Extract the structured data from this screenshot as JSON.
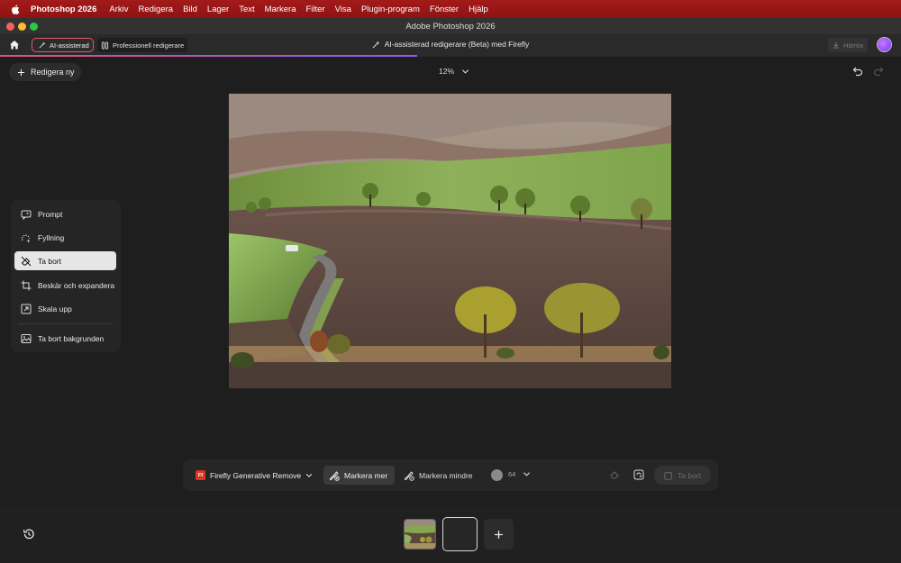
{
  "menubar": {
    "app_name": "Photoshop 2026",
    "items": [
      "Arkiv",
      "Redigera",
      "Bild",
      "Lager",
      "Text",
      "Markera",
      "Filter",
      "Visa",
      "Plugin-program",
      "Fönster",
      "Hjälp"
    ]
  },
  "window": {
    "title": "Adobe Photoshop 2026"
  },
  "toolbar": {
    "mode_ai": "AI-assisterad",
    "mode_pro": "Professionell redigerare",
    "document_title": "AI-assisterad redigerare (Beta) med Firefly",
    "download_label": "Hämta",
    "progress_fraction": 0.463
  },
  "top_controls": {
    "new_edit_label": "Redigera ny",
    "zoom_value": "12%"
  },
  "tool_panel": {
    "items": [
      {
        "label": "Prompt",
        "icon": "prompt-icon"
      },
      {
        "label": "Fyllning",
        "icon": "fill-icon"
      },
      {
        "label": "Ta bort",
        "icon": "eraser-icon",
        "active": true
      },
      {
        "label": "Beskär och expandera",
        "icon": "crop-icon"
      },
      {
        "label": "Skala upp",
        "icon": "upscale-icon"
      },
      {
        "label": "Ta bort bakgrunden",
        "icon": "remove-background-icon"
      }
    ]
  },
  "action_bar": {
    "model_label": "Firefly Generative Remove",
    "model_logo": "Ff",
    "select_more_label": "Markera mer",
    "select_less_label": "Markera mindre",
    "brush_size": "64",
    "apply_label": "Ta bort"
  },
  "colors": {
    "menubar_bg": "#9b1717",
    "accent_ai": "#e05a6a",
    "firefly": "#d7371f"
  }
}
